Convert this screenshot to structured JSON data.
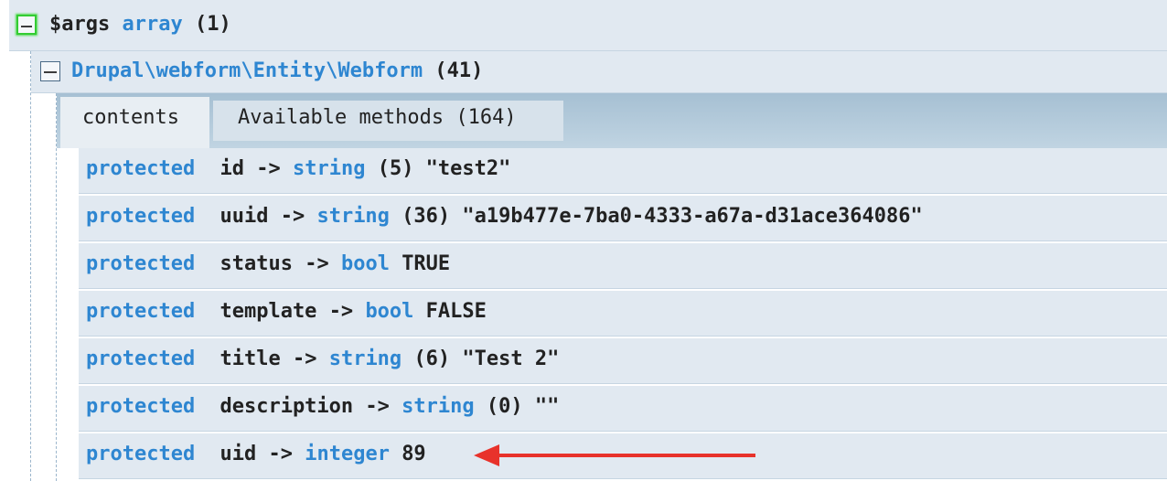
{
  "root": {
    "var_name": "$args",
    "type": "array",
    "count": "(1)"
  },
  "object": {
    "class_name": "Drupal\\webform\\Entity\\Webform",
    "count": "(41)"
  },
  "tabs": [
    {
      "label": "contents",
      "active": true
    },
    {
      "label": "Available methods (164)",
      "active": false
    }
  ],
  "properties": [
    {
      "visibility": "protected",
      "name": "id",
      "op": "->",
      "type": "string",
      "value": "(5) \"test2\""
    },
    {
      "visibility": "protected",
      "name": "uuid",
      "op": "->",
      "type": "string",
      "value": "(36) \"a19b477e-7ba0-4333-a67a-d31ace364086\""
    },
    {
      "visibility": "protected",
      "name": "status",
      "op": "->",
      "type": "bool",
      "value": "TRUE"
    },
    {
      "visibility": "protected",
      "name": "template",
      "op": "->",
      "type": "bool",
      "value": "FALSE"
    },
    {
      "visibility": "protected",
      "name": "title",
      "op": "->",
      "type": "string",
      "value": "(6) \"Test 2\""
    },
    {
      "visibility": "protected",
      "name": "description",
      "op": "->",
      "type": "string",
      "value": "(0) \"\""
    },
    {
      "visibility": "protected",
      "name": "uid",
      "op": "->",
      "type": "integer",
      "value": "89"
    }
  ],
  "colors": {
    "keyword": "#2e86d1",
    "row_bg": "#e1e9f1",
    "tab_bar": "#a6c0d3",
    "arrow": "#e8322b"
  },
  "annotation": {
    "icon": "red-arrow-icon",
    "points_to": "uid"
  }
}
